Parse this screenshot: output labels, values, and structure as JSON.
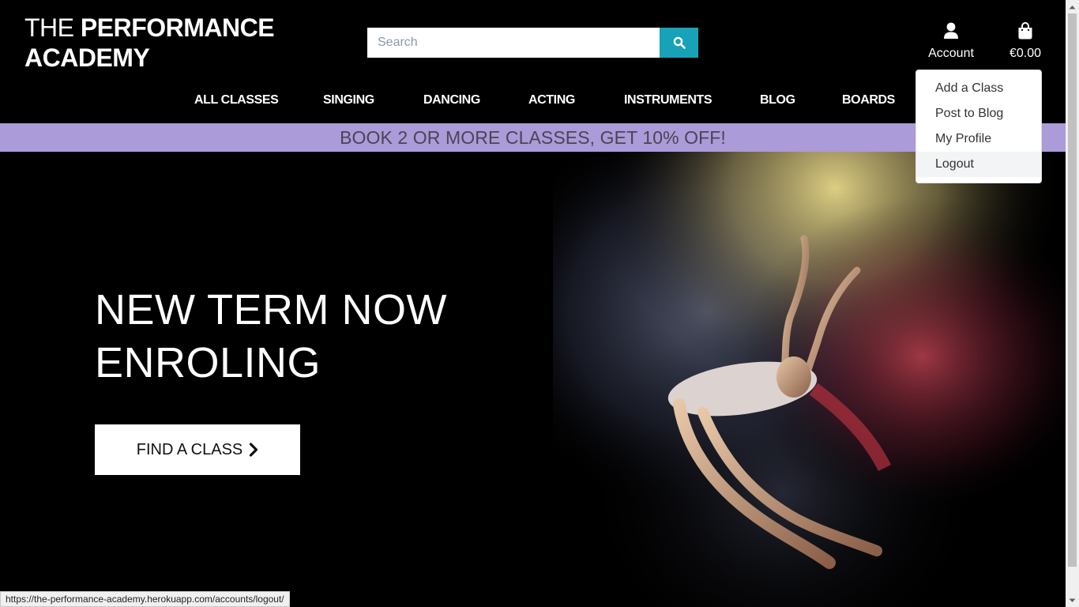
{
  "logo": {
    "light": "THE ",
    "bold_line1": "PERFORMANCE",
    "bold_line2": "ACADEMY"
  },
  "search": {
    "placeholder": "Search",
    "value": "",
    "icon": "search-icon"
  },
  "account": {
    "label": "Account",
    "icon": "user-icon"
  },
  "cart": {
    "label": "€0.00",
    "icon": "shopping-bag-icon"
  },
  "nav": {
    "items": [
      "ALL CLASSES",
      "SINGING",
      "DANCING",
      "ACTING",
      "INSTRUMENTS",
      "BLOG",
      "BOARDS"
    ]
  },
  "banner": {
    "text": "BOOK 2 OR MORE CLASSES, GET 10% OFF!"
  },
  "hero": {
    "headline_line1": "NEW TERM NOW",
    "headline_line2": "ENROLING",
    "cta_label": "FIND A CLASS",
    "cta_icon": "chevron-right-icon"
  },
  "account_menu": {
    "items": [
      "Add a Class",
      "Post to Blog",
      "My Profile",
      "Logout"
    ],
    "highlighted": "Logout"
  },
  "status_bar": {
    "url": "https://the-performance-academy.herokuapp.com/accounts/logout/"
  },
  "colors": {
    "background": "#000000",
    "search_button": "#17a2b8",
    "banner": "#ab9bd8",
    "banner_text": "#4a4457"
  }
}
